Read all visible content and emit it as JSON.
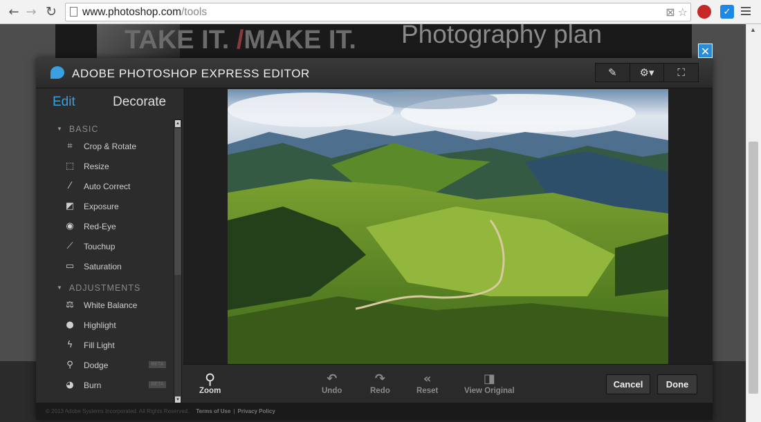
{
  "browser": {
    "url_host": "www.photoshop.com",
    "url_path": "/tools",
    "ext_badge": "✓"
  },
  "banner": {
    "take_it": "TAKE IT.",
    "make_it": "MAKE IT.",
    "plan": "Photography plan"
  },
  "editor": {
    "title": "ADOBE PHOTOSHOP EXPRESS EDITOR",
    "tabs": {
      "edit": "Edit",
      "decorate": "Decorate"
    },
    "sections": [
      {
        "label": "BASIC",
        "items": [
          "Crop & Rotate",
          "Resize",
          "Auto Correct",
          "Exposure",
          "Red-Eye",
          "Touchup",
          "Saturation"
        ]
      },
      {
        "label": "ADJUSTMENTS",
        "items": [
          "White Balance",
          "Highlight",
          "Fill Light",
          "Dodge",
          "Burn"
        ]
      }
    ],
    "beta_label": "BETA",
    "toolbar": {
      "zoom": "Zoom",
      "undo": "Undo",
      "redo": "Redo",
      "reset": "Reset",
      "view_original": "View Original",
      "cancel": "Cancel",
      "done": "Done"
    },
    "footer": {
      "copyright": "© 2013 Adobe Systems Incorporated. All Rights Reserved.",
      "terms": "Terms of Use",
      "separator": "|",
      "privacy": "Privacy Policy"
    }
  },
  "colors": {
    "accent": "#3aa0e0",
    "close_button": "#2b8cd6"
  }
}
